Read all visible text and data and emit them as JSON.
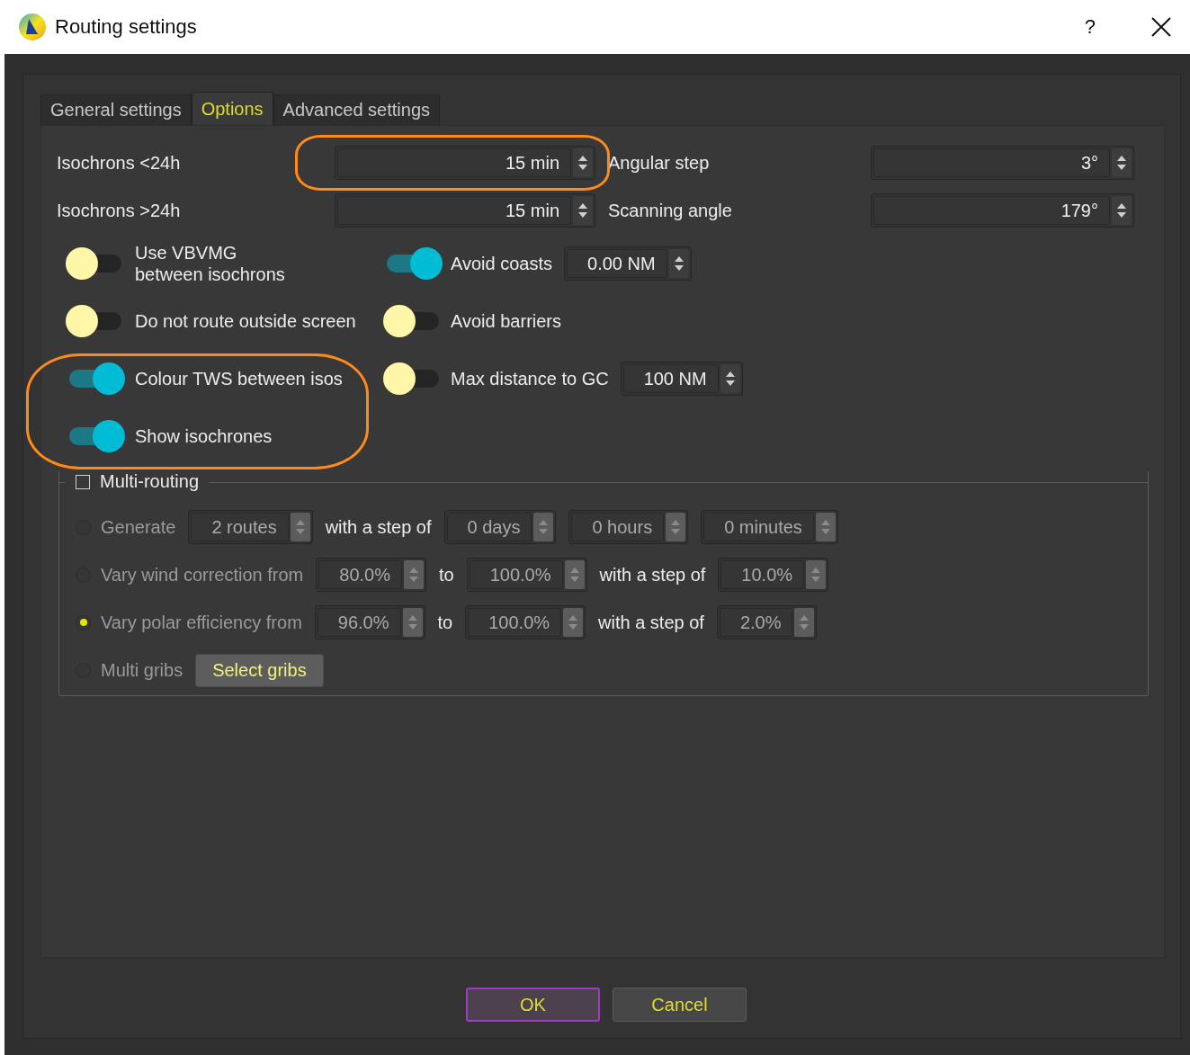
{
  "window": {
    "title": "Routing settings",
    "help_button": "?"
  },
  "tabs": [
    {
      "label": "General settings",
      "selected": false
    },
    {
      "label": "Options",
      "selected": true
    },
    {
      "label": "Advanced settings",
      "selected": false
    }
  ],
  "fields": [
    {
      "label": "Isochrons <24h",
      "value": "15 min",
      "highlighted": true
    },
    {
      "label": "Angular step",
      "value": "3°",
      "highlighted": false
    },
    {
      "label": "Isochrons >24h",
      "value": "15 min",
      "highlighted": false
    },
    {
      "label": "Scanning angle",
      "value": "179°",
      "highlighted": false
    }
  ],
  "toggles_left": [
    {
      "label": "Use VBVMG\nbetween isochrons",
      "on": false,
      "highlighted": false
    },
    {
      "label": "Do not route outside screen",
      "on": false,
      "highlighted": false
    },
    {
      "label": "Colour TWS between isos",
      "on": true,
      "highlighted": true
    },
    {
      "label": "Show isochrones",
      "on": true,
      "highlighted": true
    }
  ],
  "toggles_right": [
    {
      "label": "Avoid coasts",
      "on": true,
      "value": "0.00 NM"
    },
    {
      "label": "Avoid barriers",
      "on": false
    },
    {
      "label": "Max distance to GC",
      "on": false,
      "value": "100 NM"
    }
  ],
  "multi_routing": {
    "title": "Multi-routing",
    "checked": false,
    "rows": [
      {
        "label": "Generate",
        "selected": false,
        "parts": [
          {
            "kind": "spin",
            "value": "2 routes"
          },
          {
            "kind": "text",
            "text": "with a step of"
          },
          {
            "kind": "spin",
            "value": "0 days"
          },
          {
            "kind": "spin",
            "value": "0 hours"
          },
          {
            "kind": "spin",
            "value": "0 minutes"
          }
        ]
      },
      {
        "label": "Vary wind correction from",
        "selected": false,
        "parts": [
          {
            "kind": "spin",
            "value": "80.0%"
          },
          {
            "kind": "text",
            "text": "to"
          },
          {
            "kind": "spin",
            "value": "100.0%"
          },
          {
            "kind": "text",
            "text": "with a step of"
          },
          {
            "kind": "spin",
            "value": "10.0%"
          }
        ]
      },
      {
        "label": "Vary polar efficiency from",
        "selected": true,
        "parts": [
          {
            "kind": "spin",
            "value": "96.0%"
          },
          {
            "kind": "text",
            "text": "to"
          },
          {
            "kind": "spin",
            "value": "100.0%"
          },
          {
            "kind": "text",
            "text": "with a step of"
          },
          {
            "kind": "spin",
            "value": "2.0%"
          }
        ]
      },
      {
        "label": "Multi gribs",
        "selected": false,
        "parts": [
          {
            "kind": "button",
            "text": "Select gribs"
          }
        ]
      }
    ]
  },
  "buttons": [
    {
      "label": "OK",
      "focused": true
    },
    {
      "label": "Cancel",
      "focused": false
    }
  ]
}
